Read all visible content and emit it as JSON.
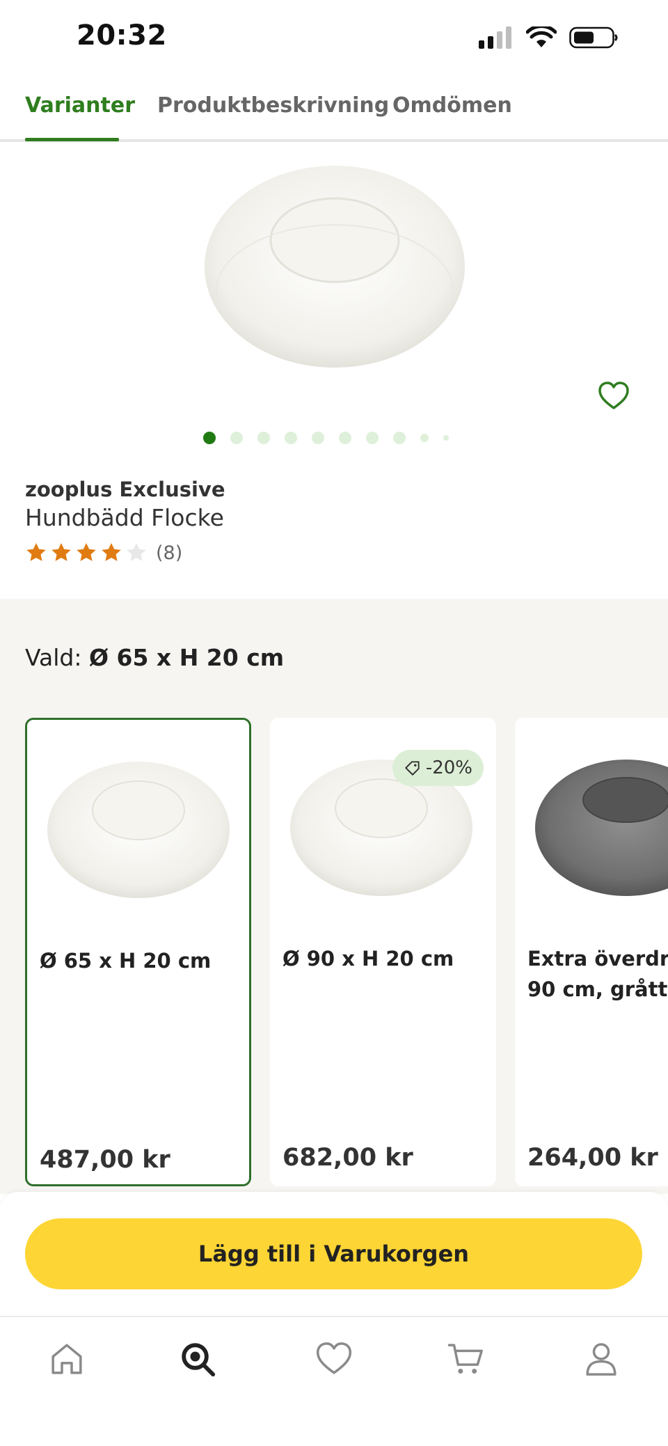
{
  "status": {
    "time": "20:32"
  },
  "tabs": [
    {
      "label": "Varianter",
      "active": true
    },
    {
      "label": "Produktbeskrivning",
      "active": false
    },
    {
      "label": "Omdömen",
      "active": false
    }
  ],
  "product": {
    "brand": "zooplus Exclusive",
    "name": "Hundbädd Flocke",
    "rating": 4,
    "rating_max": 5,
    "review_count": "(8)",
    "image_index": 1,
    "image_count": 10
  },
  "variants": {
    "selected_prefix": "Vald:",
    "selected_value": "Ø 65 x H 20 cm",
    "items": [
      {
        "title_lines": [
          "Ø 65 x H 20 cm"
        ],
        "price": "487,00 kr",
        "selected": true,
        "badge": ""
      },
      {
        "title_lines": [
          "Ø 90 x H 20 cm"
        ],
        "price": "682,00 kr",
        "selected": false,
        "badge": "-20%"
      },
      {
        "title_lines": [
          "Extra överdrag",
          "90 cm, grått"
        ],
        "price": "264,00 kr",
        "selected": false,
        "badge": ""
      }
    ]
  },
  "cart": {
    "add_label": "Lägg till i Varukorgen"
  },
  "nav": [
    "home-icon",
    "search-icon",
    "heart-icon",
    "cart-icon",
    "profile-icon"
  ],
  "colors": {
    "accent_green": "#2f7d1f",
    "star_orange": "#e07b12",
    "button_yellow": "#fdd535",
    "badge_green": "#dcefd6",
    "section_bg": "#f6f5f2"
  }
}
